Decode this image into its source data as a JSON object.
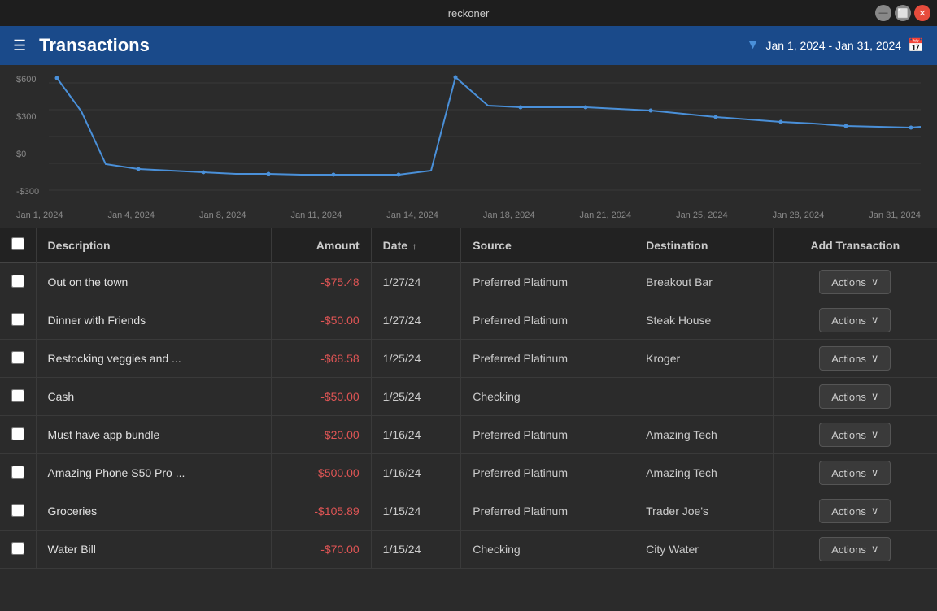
{
  "titlebar": {
    "title": "reckoner",
    "min_label": "—",
    "max_label": "⬜",
    "close_label": "✕"
  },
  "header": {
    "menu_icon": "☰",
    "title": "Transactions",
    "filter_icon": "▼",
    "date_range": "Jan 1, 2024 - Jan 31, 2024",
    "calendar_icon": "📅"
  },
  "chart": {
    "y_labels": [
      "$600",
      "$300",
      "$0",
      "-$300"
    ],
    "x_labels": [
      "Jan 1, 2024",
      "Jan 4, 2024",
      "Jan 8, 2024",
      "Jan 11, 2024",
      "Jan 14, 2024",
      "Jan 18, 2024",
      "Jan 21, 2024",
      "Jan 25, 2024",
      "Jan 28, 2024",
      "Jan 31, 2024"
    ]
  },
  "table": {
    "columns": {
      "description": "Description",
      "amount": "Amount",
      "date": "Date",
      "source": "Source",
      "destination": "Destination",
      "action": "Add Transaction"
    },
    "rows": [
      {
        "description": "Out on the town",
        "amount": "-$75.48",
        "date": "1/27/24",
        "source": "Preferred Platinum",
        "destination": "Breakout Bar",
        "actions": "Actions"
      },
      {
        "description": "Dinner with Friends",
        "amount": "-$50.00",
        "date": "1/27/24",
        "source": "Preferred Platinum",
        "destination": "Steak House",
        "actions": "Actions"
      },
      {
        "description": "Restocking veggies and ...",
        "amount": "-$68.58",
        "date": "1/25/24",
        "source": "Preferred Platinum",
        "destination": "Kroger",
        "actions": "Actions"
      },
      {
        "description": "Cash",
        "amount": "-$50.00",
        "date": "1/25/24",
        "source": "Checking",
        "destination": "",
        "actions": "Actions"
      },
      {
        "description": "Must have app bundle",
        "amount": "-$20.00",
        "date": "1/16/24",
        "source": "Preferred Platinum",
        "destination": "Amazing Tech",
        "actions": "Actions"
      },
      {
        "description": "Amazing Phone S50 Pro ...",
        "amount": "-$500.00",
        "date": "1/16/24",
        "source": "Preferred Platinum",
        "destination": "Amazing Tech",
        "actions": "Actions"
      },
      {
        "description": "Groceries",
        "amount": "-$105.89",
        "date": "1/15/24",
        "source": "Preferred Platinum",
        "destination": "Trader Joe's",
        "actions": "Actions"
      },
      {
        "description": "Water Bill",
        "amount": "-$70.00",
        "date": "1/15/24",
        "source": "Checking",
        "destination": "City Water",
        "actions": "Actions"
      }
    ],
    "actions_chevron": "∨"
  }
}
